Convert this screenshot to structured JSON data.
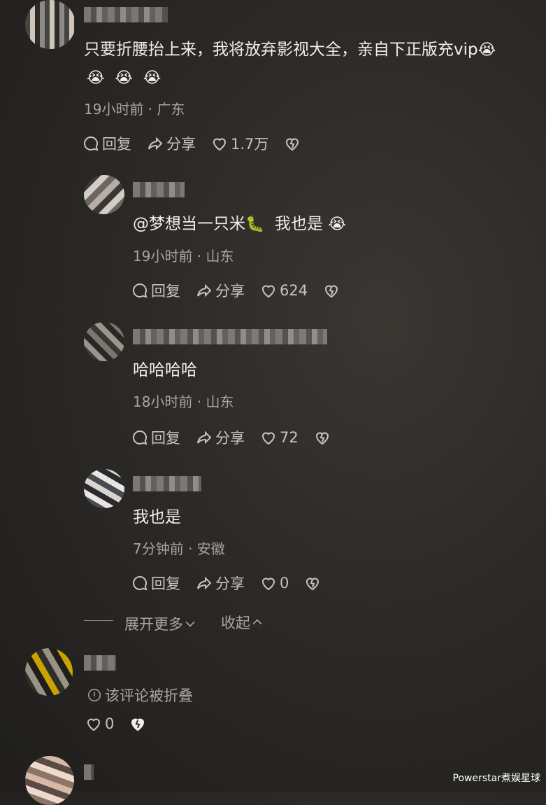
{
  "comments": [
    {
      "text": "只要折腰抬上来，我将放弃影视大全，亲自下正版充vip",
      "emojis": [
        "😭",
        "😭",
        "😭",
        "😭"
      ],
      "meta": "19小时前 · 广东",
      "reply_label": "回复",
      "share_label": "分享",
      "likes": "1.7万"
    }
  ],
  "replies": [
    {
      "mention": "@梦想当一只米",
      "mention_emoji": "🐛",
      "text": "我也是",
      "emoji": "😭",
      "meta": "19小时前 · 山东",
      "reply_label": "回复",
      "share_label": "分享",
      "likes": "624"
    },
    {
      "text": "哈哈哈哈",
      "meta": "18小时前 · 山东",
      "reply_label": "回复",
      "share_label": "分享",
      "likes": "72"
    },
    {
      "text": "我也是",
      "meta": "7分钟前 · 安徽",
      "reply_label": "回复",
      "share_label": "分享",
      "likes": "0"
    }
  ],
  "thread_controls": {
    "expand_label": "展开更多",
    "collapse_label": "收起"
  },
  "folded_comment": {
    "notice": "该评论被折叠",
    "likes": "0"
  },
  "watermark": "Powerstar煮娱星球",
  "icons": [
    "reply-icon",
    "share-icon",
    "heart-icon",
    "dislike-icon",
    "chevron-down-icon",
    "chevron-up-icon",
    "info-icon"
  ]
}
